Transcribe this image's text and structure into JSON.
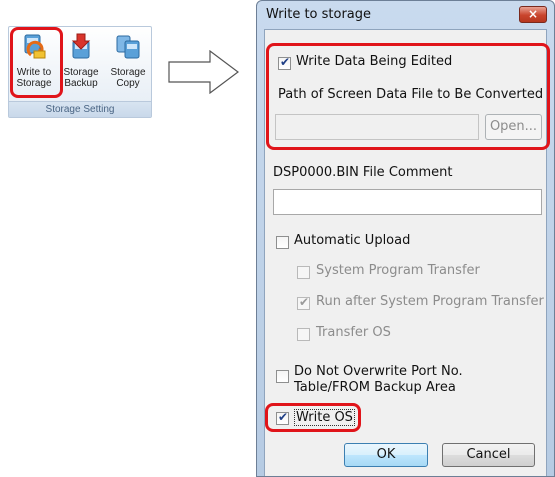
{
  "ribbon": {
    "buttons": [
      {
        "label_line1": "Write to",
        "label_line2": "Storage",
        "icon": "write-storage-icon"
      },
      {
        "label_line1": "Storage",
        "label_line2": "Backup",
        "icon": "storage-backup-icon"
      },
      {
        "label_line1": "Storage",
        "label_line2": "Copy",
        "icon": "storage-copy-icon"
      }
    ],
    "group_label": "Storage Setting"
  },
  "dialog": {
    "title": "Write to storage",
    "close_glyph": "×",
    "write_data_being_edited": {
      "label": "Write Data Being Edited",
      "checked": true
    },
    "path_label": "Path of Screen Data File to Be Converted",
    "path_value": "",
    "open_button": "Open...",
    "comment_label": "DSP0000.BIN File Comment",
    "comment_value": "",
    "automatic_upload": {
      "label": "Automatic Upload",
      "checked": false
    },
    "system_program_transfer": {
      "label": "System Program Transfer",
      "checked": false
    },
    "run_after_transfer": {
      "label": "Run after System Program Transfer",
      "checked": true
    },
    "transfer_os": {
      "label": "Transfer OS",
      "checked": false
    },
    "do_not_overwrite": {
      "label_line1": "Do Not Overwrite Port No.",
      "label_line2": "Table/FROM Backup Area",
      "checked": false
    },
    "write_os": {
      "label": "Write OS",
      "checked": true
    },
    "ok_button": "OK",
    "cancel_button": "Cancel"
  },
  "colors": {
    "highlight": "#e0141a",
    "dialog_frame": "#b6cbe3",
    "default_button": "#a7d9f5"
  }
}
